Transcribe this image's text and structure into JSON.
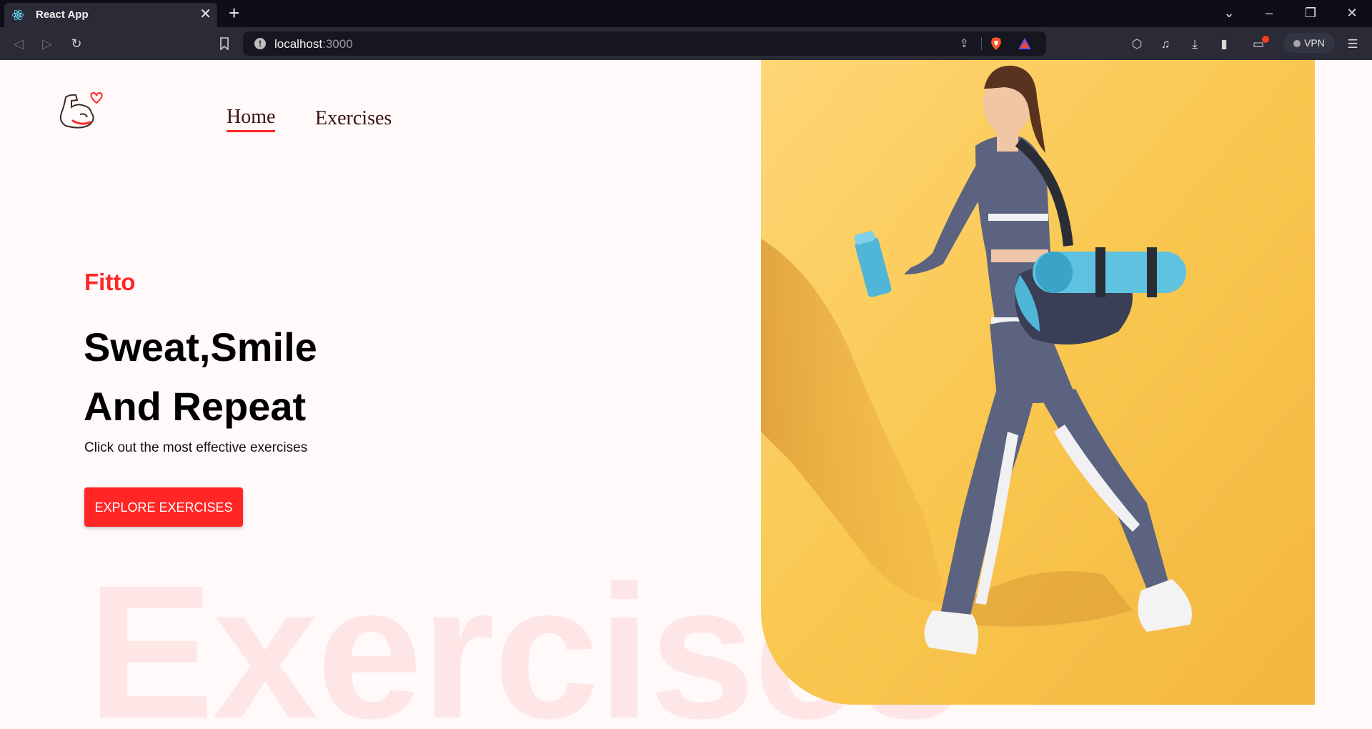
{
  "browser": {
    "tab_title": "React App",
    "url_host": "localhost",
    "url_port": ":3000",
    "vpn_label": "VPN"
  },
  "page": {
    "nav": {
      "home": "Home",
      "exercises": "Exercises"
    },
    "brand": "Fitto",
    "headline_line1": "Sweat,Smile",
    "headline_line2": "And Repeat",
    "subtitle": "Click out the most effective exercises",
    "cta_label": "EXPLORE EXERCISES",
    "background_word": "Exercises",
    "hero_image": "woman-walking-with-gym-bag"
  },
  "colors": {
    "accent": "#ff2625",
    "hero_bg": "#f9c74f",
    "page_bg": "#fff9f9",
    "bg_word": "#ffe6e6"
  }
}
